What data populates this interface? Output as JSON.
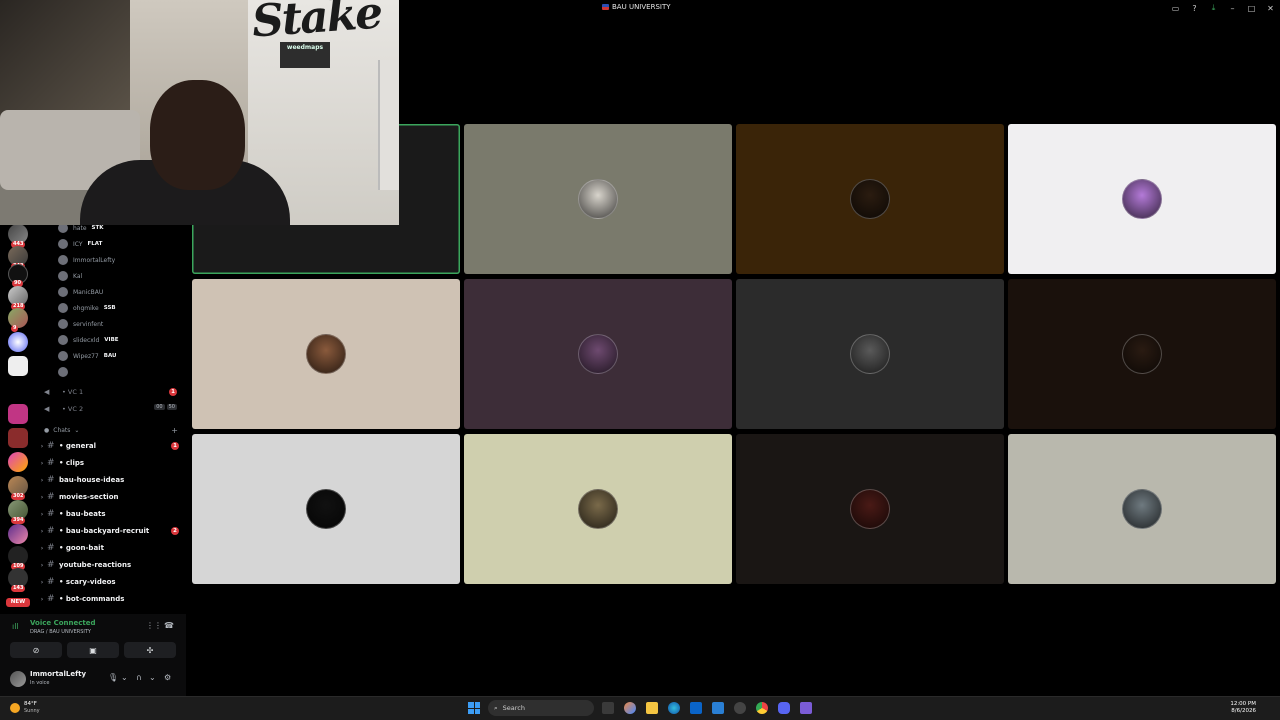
{
  "window": {
    "title": "BAU UNIVERSITY"
  },
  "server_badges": [
    "443",
    "343",
    "90",
    "218",
    "9",
    "302",
    "394",
    "109",
    "143"
  ],
  "server_new": "NEW",
  "members": [
    {
      "name": "hate",
      "tag": "STK"
    },
    {
      "name": "ICY",
      "tag": "FLAT"
    },
    {
      "name": "ImmortalLefty",
      "tag": ""
    },
    {
      "name": "Kal",
      "tag": ""
    },
    {
      "name": "ManicBAU",
      "tag": ""
    },
    {
      "name": "ohgmike",
      "tag": "SSB"
    },
    {
      "name": "servinfent",
      "tag": ""
    },
    {
      "name": "slidecxld",
      "tag": "VIBE"
    },
    {
      "name": "Wipez77",
      "tag": "BAU"
    }
  ],
  "voice_channels": [
    {
      "name": "VC 1",
      "badge": "1"
    },
    {
      "name": "VC 2",
      "counts": [
        "00",
        "50"
      ]
    }
  ],
  "category": {
    "name": "Chats"
  },
  "channels": [
    {
      "name": "general",
      "bullet": true,
      "badge": "1"
    },
    {
      "name": "clips",
      "bullet": true
    },
    {
      "name": "bau-house-ideas",
      "bullet": false
    },
    {
      "name": "movies-section",
      "bullet": false
    },
    {
      "name": "bau-beats",
      "bullet": true
    },
    {
      "name": "bau-backyard-recruit",
      "bullet": true,
      "badge": "2"
    },
    {
      "name": "goon-bait",
      "bullet": true
    },
    {
      "name": "youtube-reactions",
      "bullet": false
    },
    {
      "name": "scary-videos",
      "bullet": true
    },
    {
      "name": "bot-commands",
      "bullet": true
    }
  ],
  "voice_panel": {
    "status": "Voice Connected",
    "location": "DRAG / BAU UNIVERSITY"
  },
  "user": {
    "name": "ImmortalLefty",
    "status": "In voice"
  },
  "webcam": {
    "logo": "Stake",
    "sign": "weedmaps"
  },
  "tiles": [
    {
      "bg": "#1a1a1a",
      "avatar": "",
      "speaking": true
    },
    {
      "bg": "#7a7a6c",
      "avatar": "#d8d4cc"
    },
    {
      "bg": "#3a2408",
      "avatar": "#2b1c10"
    },
    {
      "bg": "#f0eff1",
      "avatar": "#b47ad8"
    },
    {
      "bg": "#cfc2b4",
      "avatar": "#8a5a3c"
    },
    {
      "bg": "#3d2d38",
      "avatar": "#6e4a70"
    },
    {
      "bg": "#2b2b2b",
      "avatar": "#5a5a5a"
    },
    {
      "bg": "#1a110c",
      "avatar": "#2a1b12"
    },
    {
      "bg": "#d6d6d6",
      "avatar": "#111111"
    },
    {
      "bg": "#cfcfae",
      "avatar": "#7a6a4a"
    },
    {
      "bg": "#1a1614",
      "avatar": "#4a1a16"
    },
    {
      "bg": "#b9b8ad",
      "avatar": "#6f7a80"
    }
  ],
  "taskbar": {
    "temp": "84°F",
    "weather": "Sunny",
    "search": "Search",
    "time": "12:00 PM",
    "date": "8/6/2026"
  },
  "colors": {
    "green": "#3ba55c",
    "red": "#da373c",
    "blurple": "#5865f2"
  }
}
